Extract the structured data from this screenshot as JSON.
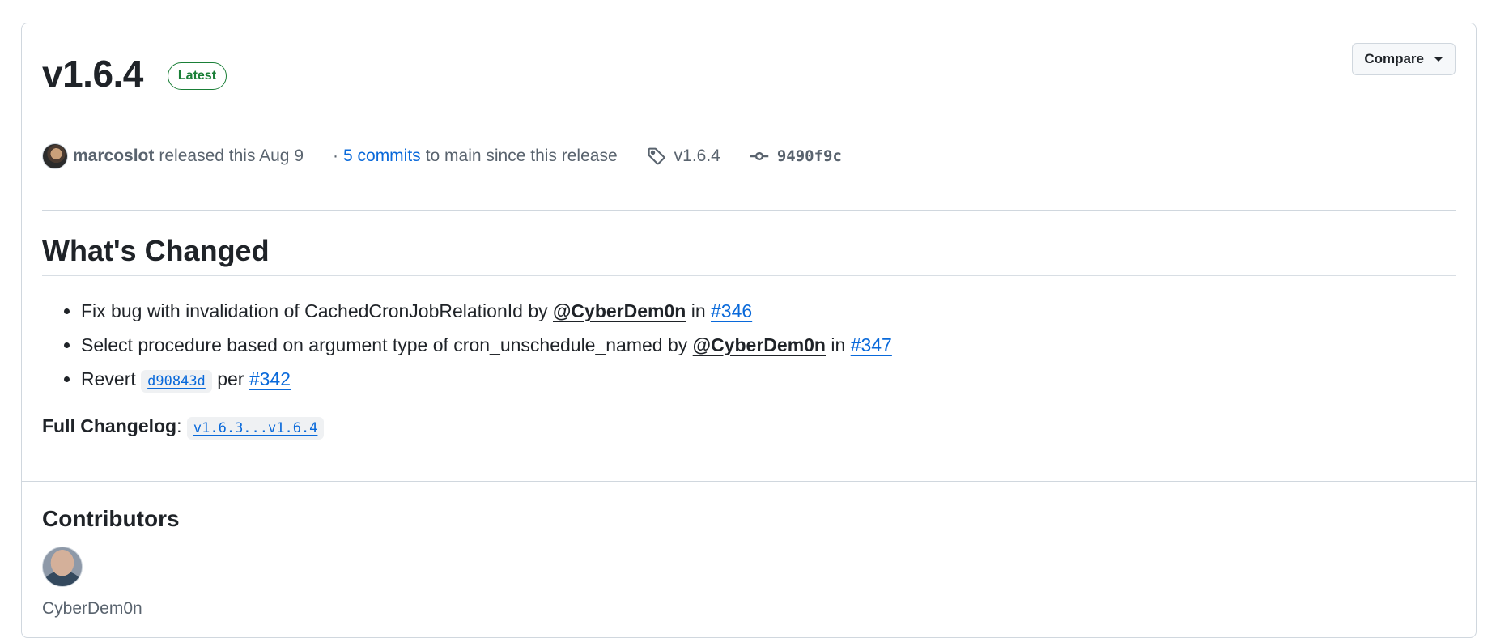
{
  "release": {
    "title": "v1.6.4",
    "badge": "Latest",
    "compare_label": "Compare",
    "author": "marcoslot",
    "released_text": "released this Aug 9",
    "commits_prefix": "·",
    "commits_link": "5 commits",
    "commits_suffix": "to main since this release",
    "tag": "v1.6.4",
    "commit_sha": "9490f9c"
  },
  "notes": {
    "heading": "What's Changed",
    "items": [
      {
        "text": "Fix bug with invalidation of CachedCronJobRelationId by",
        "mention": "@CyberDem0n",
        "in_word": "in",
        "pr": "#346"
      },
      {
        "text": "Select procedure based on argument type of cron_unschedule_named by",
        "mention": "@CyberDem0n",
        "in_word": "in",
        "pr": "#347"
      },
      {
        "prefix": "Revert",
        "commit": "d90843d",
        "per_word": "per",
        "pr": "#342"
      }
    ],
    "full_changelog_label": "Full Changelog",
    "full_changelog_colon": ":",
    "full_changelog_link": "v1.6.3...v1.6.4"
  },
  "contributors": {
    "heading": "Contributors",
    "people": [
      {
        "name": "CyberDem0n"
      }
    ]
  },
  "colors": {
    "link": "#0969da",
    "badge_green": "#1a7f37",
    "border": "#d0d7de",
    "muted_text": "#59636e"
  },
  "icons": {
    "tag": "tag-icon",
    "commit": "git-commit-icon",
    "caret": "triangle-down-icon"
  }
}
